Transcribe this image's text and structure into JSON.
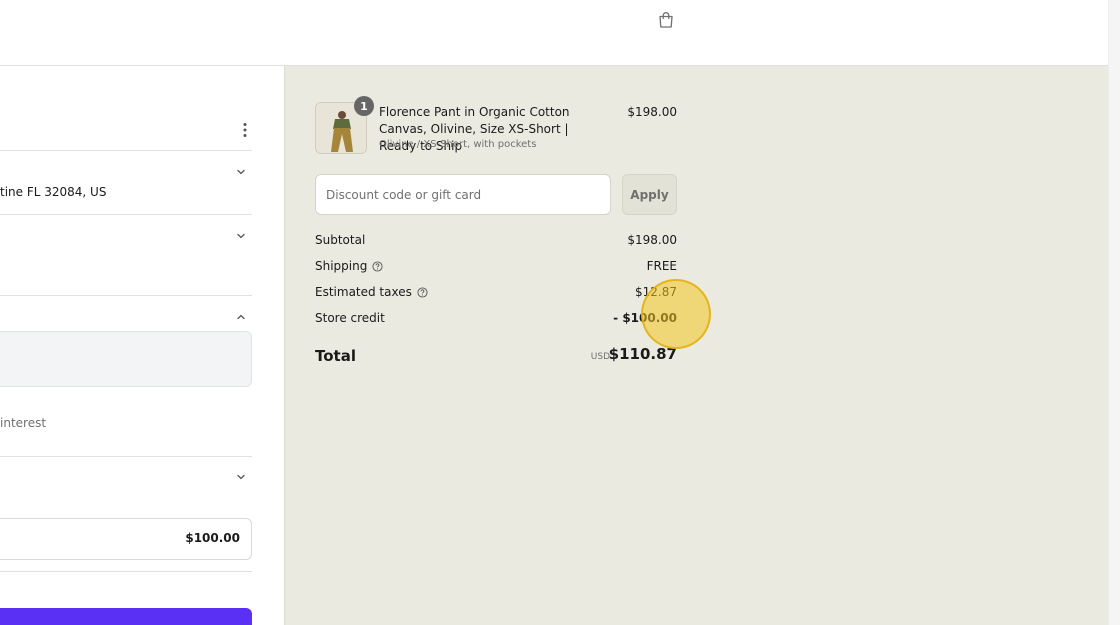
{
  "header": {
    "cart_icon": "shopping-bag-icon"
  },
  "left_panel": {
    "shipping_address_text": "tine FL 32084, US",
    "installments_text": "interest",
    "store_credit_amount": "$100.00"
  },
  "order_summary": {
    "item": {
      "quantity": "1",
      "title": "Florence Pant in Organic Cotton Canvas, Olivine, Size XS-Short | Ready to Ship",
      "variant": "Olivine / XS-Short, with pockets",
      "price": "$198.00"
    },
    "discount": {
      "placeholder": "Discount code or gift card",
      "value": "",
      "apply_label": "Apply"
    },
    "lines": {
      "subtotal_label": "Subtotal",
      "subtotal_value": "$198.00",
      "shipping_label": "Shipping",
      "shipping_value": "FREE",
      "taxes_label": "Estimated taxes",
      "taxes_value": "$12.87",
      "credit_label": "Store credit",
      "credit_value": "- $100.00"
    },
    "total": {
      "label": "Total",
      "currency": "USD",
      "value": "$110.87"
    }
  },
  "colors": {
    "summary_background": "#ebeae0",
    "pay_button": "#5a31f4",
    "cursor_highlight": "#f2c420"
  }
}
